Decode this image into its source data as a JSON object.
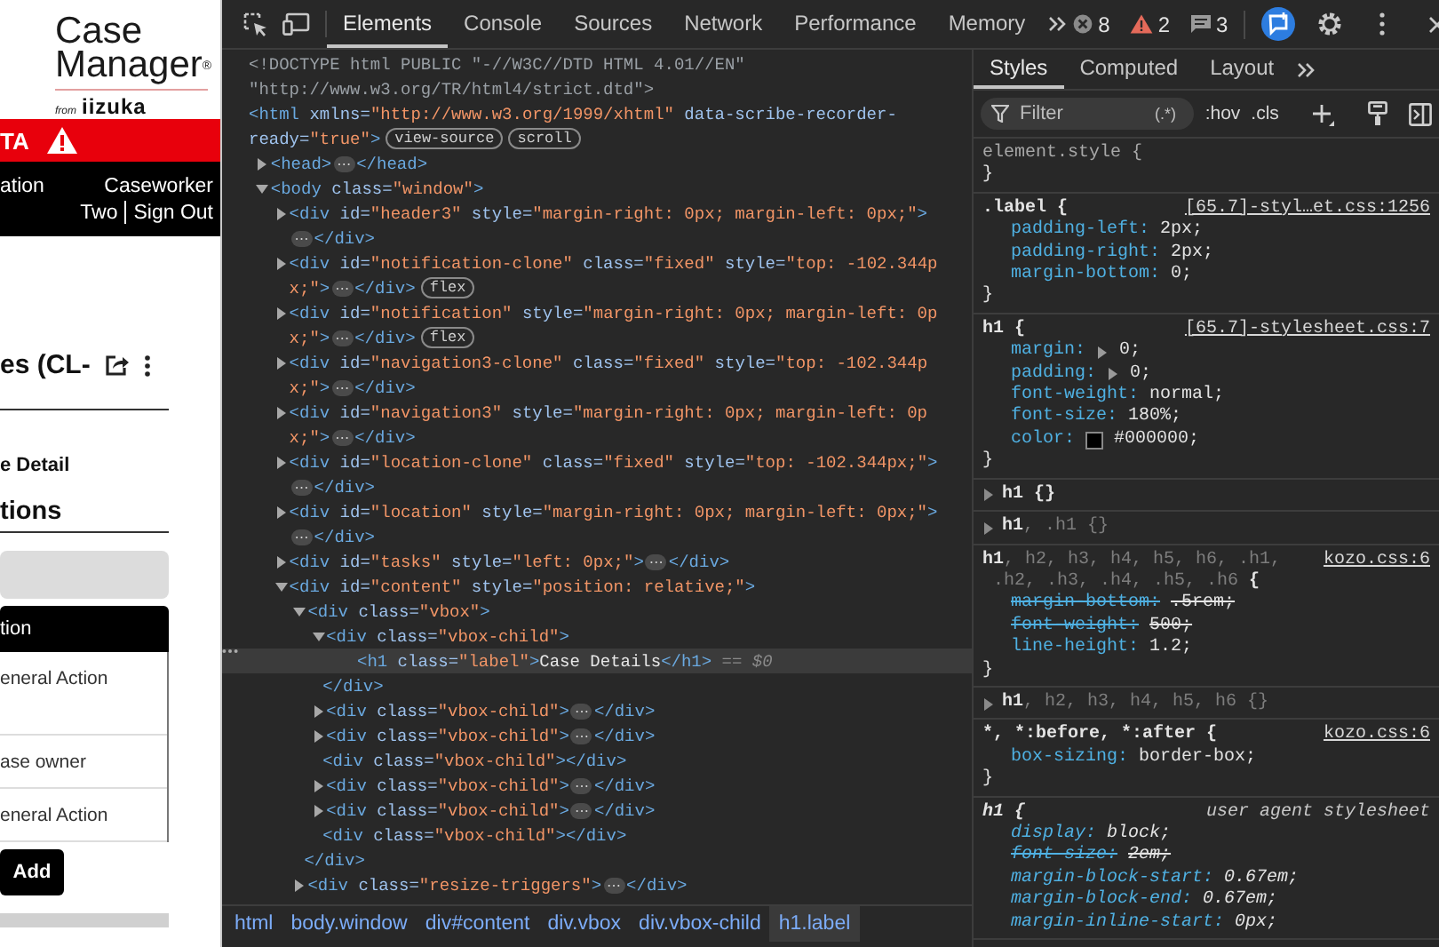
{
  "app_preview": {
    "logo": {
      "title_lines": [
        "Case",
        "Manager"
      ],
      "mark": "®",
      "byline_prefix": "from",
      "byline_brand": "iizuka"
    },
    "alert_bar": {
      "text": "TA"
    },
    "nav": {
      "left": "ation",
      "user_first": "Caseworker",
      "user_second": "Two",
      "sign_out": "Sign Out"
    },
    "case_title": "es (CL-",
    "section_label": "e Detail",
    "section_heading": "tions",
    "actions_header": "tion",
    "action_items": [
      {
        "text": "eneral Action"
      },
      {
        "text": "ase owner"
      },
      {
        "text": "eneral Action"
      }
    ],
    "add_button": "Add"
  },
  "devtools": {
    "toolbar": {
      "tabs": [
        {
          "label": "Elements",
          "selected": true
        },
        {
          "label": "Console",
          "selected": false
        },
        {
          "label": "Sources",
          "selected": false
        },
        {
          "label": "Network",
          "selected": false
        },
        {
          "label": "Performance",
          "selected": false
        },
        {
          "label": "Memory",
          "selected": false
        }
      ],
      "errors": "8",
      "warnings": "2",
      "messages": "3"
    },
    "elements": {
      "tree": [
        {
          "selected": false,
          "lines": [
            [
              {
                "kind": "doctype",
                "text": "<!DOCTYPE html PUBLIC \"-//W3C//DTD HTML 4.01//EN\""
              }
            ],
            [
              {
                "kind": "doctype",
                "text": "\"http://www.w3.org/TR/html4/strict.dtd\">"
              }
            ]
          ]
        },
        {
          "selected": false,
          "lines": [
            [
              {
                "kind": "tag",
                "text": "<html"
              },
              {
                "kind": "attr",
                "text": " xmlns="
              },
              {
                "kind": "value",
                "text": "\"http://www.w3.org/1999/xhtml\""
              },
              {
                "kind": "attr",
                "text": " data-scribe-recorder-"
              }
            ],
            [
              {
                "kind": "attr",
                "text": "ready="
              },
              {
                "kind": "value",
                "text": "\"true\""
              },
              {
                "kind": "tag",
                "text": ">"
              },
              {
                "kind": "badge",
                "text": "view-source"
              },
              {
                "kind": "badge",
                "text": "scroll"
              }
            ]
          ],
          "children": [
            {
              "selected": false,
              "expanded": false,
              "lines": [
                [
                  {
                    "kind": "tag",
                    "text": "<head>"
                  },
                  {
                    "kind": "ellipsis",
                    "text": "⋯"
                  },
                  {
                    "kind": "tag",
                    "text": "</head>"
                  }
                ]
              ]
            },
            {
              "selected": false,
              "expanded": true,
              "lines": [
                [
                  {
                    "kind": "tag",
                    "text": "<body"
                  },
                  {
                    "kind": "attr",
                    "text": " class="
                  },
                  {
                    "kind": "value",
                    "text": "\"window\""
                  },
                  {
                    "kind": "tag",
                    "text": ">"
                  }
                ]
              ],
              "children": [
                {
                  "selected": false,
                  "expanded": false,
                  "lines": [
                    [
                      {
                        "kind": "tag",
                        "text": "<div"
                      },
                      {
                        "kind": "attr",
                        "text": " id="
                      },
                      {
                        "kind": "value",
                        "text": "\"header3\""
                      },
                      {
                        "kind": "attr",
                        "text": " style="
                      },
                      {
                        "kind": "value",
                        "text": "\"margin-right: 0px; margin-left: 0px;\""
                      },
                      {
                        "kind": "tag",
                        "text": ">"
                      }
                    ],
                    [
                      {
                        "kind": "ellipsis",
                        "text": "⋯"
                      },
                      {
                        "kind": "tag",
                        "text": "</div>"
                      }
                    ]
                  ]
                },
                {
                  "selected": false,
                  "expanded": false,
                  "lines": [
                    [
                      {
                        "kind": "tag",
                        "text": "<div"
                      },
                      {
                        "kind": "attr",
                        "text": " id="
                      },
                      {
                        "kind": "value",
                        "text": "\"notification-clone\""
                      },
                      {
                        "kind": "attr",
                        "text": " class="
                      },
                      {
                        "kind": "value",
                        "text": "\"fixed\""
                      },
                      {
                        "kind": "attr",
                        "text": " style="
                      },
                      {
                        "kind": "value",
                        "text": "\"top: -102.344p"
                      }
                    ],
                    [
                      {
                        "kind": "value",
                        "text": "x;\""
                      },
                      {
                        "kind": "tag",
                        "text": ">"
                      },
                      {
                        "kind": "ellipsis",
                        "text": "⋯"
                      },
                      {
                        "kind": "tag",
                        "text": "</div>"
                      },
                      {
                        "kind": "badge",
                        "text": "flex"
                      }
                    ]
                  ]
                },
                {
                  "selected": false,
                  "expanded": false,
                  "lines": [
                    [
                      {
                        "kind": "tag",
                        "text": "<div"
                      },
                      {
                        "kind": "attr",
                        "text": " id="
                      },
                      {
                        "kind": "value",
                        "text": "\"notification\""
                      },
                      {
                        "kind": "attr",
                        "text": " style="
                      },
                      {
                        "kind": "value",
                        "text": "\"margin-right: 0px; margin-left: 0p"
                      }
                    ],
                    [
                      {
                        "kind": "value",
                        "text": "x;\""
                      },
                      {
                        "kind": "tag",
                        "text": ">"
                      },
                      {
                        "kind": "ellipsis",
                        "text": "⋯"
                      },
                      {
                        "kind": "tag",
                        "text": "</div>"
                      },
                      {
                        "kind": "badge",
                        "text": "flex"
                      }
                    ]
                  ]
                },
                {
                  "selected": false,
                  "expanded": false,
                  "lines": [
                    [
                      {
                        "kind": "tag",
                        "text": "<div"
                      },
                      {
                        "kind": "attr",
                        "text": " id="
                      },
                      {
                        "kind": "value",
                        "text": "\"navigation3-clone\""
                      },
                      {
                        "kind": "attr",
                        "text": " class="
                      },
                      {
                        "kind": "value",
                        "text": "\"fixed\""
                      },
                      {
                        "kind": "attr",
                        "text": " style="
                      },
                      {
                        "kind": "value",
                        "text": "\"top: -102.344p"
                      }
                    ],
                    [
                      {
                        "kind": "value",
                        "text": "x;\""
                      },
                      {
                        "kind": "tag",
                        "text": ">"
                      },
                      {
                        "kind": "ellipsis",
                        "text": "⋯"
                      },
                      {
                        "kind": "tag",
                        "text": "</div>"
                      }
                    ]
                  ]
                },
                {
                  "selected": false,
                  "expanded": false,
                  "lines": [
                    [
                      {
                        "kind": "tag",
                        "text": "<div"
                      },
                      {
                        "kind": "attr",
                        "text": " id="
                      },
                      {
                        "kind": "value",
                        "text": "\"navigation3\""
                      },
                      {
                        "kind": "attr",
                        "text": " style="
                      },
                      {
                        "kind": "value",
                        "text": "\"margin-right: 0px; margin-left: 0p"
                      }
                    ],
                    [
                      {
                        "kind": "value",
                        "text": "x;\""
                      },
                      {
                        "kind": "tag",
                        "text": ">"
                      },
                      {
                        "kind": "ellipsis",
                        "text": "⋯"
                      },
                      {
                        "kind": "tag",
                        "text": "</div>"
                      }
                    ]
                  ]
                },
                {
                  "selected": false,
                  "expanded": false,
                  "lines": [
                    [
                      {
                        "kind": "tag",
                        "text": "<div"
                      },
                      {
                        "kind": "attr",
                        "text": " id="
                      },
                      {
                        "kind": "value",
                        "text": "\"location-clone\""
                      },
                      {
                        "kind": "attr",
                        "text": " class="
                      },
                      {
                        "kind": "value",
                        "text": "\"fixed\""
                      },
                      {
                        "kind": "attr",
                        "text": " style="
                      },
                      {
                        "kind": "value",
                        "text": "\"top: -102.344px;\""
                      },
                      {
                        "kind": "tag",
                        "text": ">"
                      }
                    ],
                    [
                      {
                        "kind": "ellipsis",
                        "text": "⋯"
                      },
                      {
                        "kind": "tag",
                        "text": "</div>"
                      }
                    ]
                  ]
                },
                {
                  "selected": false,
                  "expanded": false,
                  "lines": [
                    [
                      {
                        "kind": "tag",
                        "text": "<div"
                      },
                      {
                        "kind": "attr",
                        "text": " id="
                      },
                      {
                        "kind": "value",
                        "text": "\"location\""
                      },
                      {
                        "kind": "attr",
                        "text": " style="
                      },
                      {
                        "kind": "value",
                        "text": "\"margin-right: 0px; margin-left: 0px;\""
                      },
                      {
                        "kind": "tag",
                        "text": ">"
                      }
                    ],
                    [
                      {
                        "kind": "ellipsis",
                        "text": "⋯"
                      },
                      {
                        "kind": "tag",
                        "text": "</div>"
                      }
                    ]
                  ]
                },
                {
                  "selected": false,
                  "expanded": false,
                  "lines": [
                    [
                      {
                        "kind": "tag",
                        "text": "<div"
                      },
                      {
                        "kind": "attr",
                        "text": " id="
                      },
                      {
                        "kind": "value",
                        "text": "\"tasks\""
                      },
                      {
                        "kind": "attr",
                        "text": " style="
                      },
                      {
                        "kind": "value",
                        "text": "\"left: 0px;\""
                      },
                      {
                        "kind": "tag",
                        "text": ">"
                      },
                      {
                        "kind": "ellipsis",
                        "text": "⋯"
                      },
                      {
                        "kind": "tag",
                        "text": "</div>"
                      }
                    ]
                  ]
                },
                {
                  "selected": false,
                  "expanded": true,
                  "lines": [
                    [
                      {
                        "kind": "tag",
                        "text": "<div"
                      },
                      {
                        "kind": "attr",
                        "text": " id="
                      },
                      {
                        "kind": "value",
                        "text": "\"content\""
                      },
                      {
                        "kind": "attr",
                        "text": " style="
                      },
                      {
                        "kind": "value",
                        "text": "\"position: relative;\""
                      },
                      {
                        "kind": "tag",
                        "text": ">"
                      }
                    ]
                  ],
                  "children": [
                    {
                      "selected": false,
                      "expanded": true,
                      "lines": [
                        [
                          {
                            "kind": "tag",
                            "text": "<div"
                          },
                          {
                            "kind": "attr",
                            "text": " class="
                          },
                          {
                            "kind": "value",
                            "text": "\"vbox\""
                          },
                          {
                            "kind": "tag",
                            "text": ">"
                          }
                        ]
                      ],
                      "closing": [
                        {
                          "kind": "tag",
                          "text": "</div>"
                        }
                      ],
                      "children": [
                        {
                          "selected": false,
                          "expanded": true,
                          "lines": [
                            [
                              {
                                "kind": "tag",
                                "text": "<div"
                              },
                              {
                                "kind": "attr",
                                "text": " class="
                              },
                              {
                                "kind": "value",
                                "text": "\"vbox-child\""
                              },
                              {
                                "kind": "tag",
                                "text": ">"
                              }
                            ]
                          ],
                          "closing": [
                            {
                              "kind": "tag",
                              "text": "</div>"
                            }
                          ],
                          "children": [
                            {
                              "selected": true,
                              "lines": [
                                [
                                  {
                                    "kind": "tag",
                                    "text": "<h1"
                                  },
                                  {
                                    "kind": "attr",
                                    "text": " class="
                                  },
                                  {
                                    "kind": "value",
                                    "text": "\"label\""
                                  },
                                  {
                                    "kind": "tag",
                                    "text": ">"
                                  },
                                  {
                                    "kind": "text",
                                    "text": "Case Details"
                                  },
                                  {
                                    "kind": "tag",
                                    "text": "</h1>"
                                  },
                                  {
                                    "kind": "marker",
                                    "text": " == $0"
                                  }
                                ]
                              ]
                            }
                          ]
                        },
                        {
                          "selected": false,
                          "expanded": false,
                          "lines": [
                            [
                              {
                                "kind": "tag",
                                "text": "<div"
                              },
                              {
                                "kind": "attr",
                                "text": " class="
                              },
                              {
                                "kind": "value",
                                "text": "\"vbox-child\""
                              },
                              {
                                "kind": "tag",
                                "text": ">"
                              },
                              {
                                "kind": "ellipsis",
                                "text": "⋯"
                              },
                              {
                                "kind": "tag",
                                "text": "</div>"
                              }
                            ]
                          ]
                        },
                        {
                          "selected": false,
                          "expanded": false,
                          "lines": [
                            [
                              {
                                "kind": "tag",
                                "text": "<div"
                              },
                              {
                                "kind": "attr",
                                "text": " class="
                              },
                              {
                                "kind": "value",
                                "text": "\"vbox-child\""
                              },
                              {
                                "kind": "tag",
                                "text": ">"
                              },
                              {
                                "kind": "ellipsis",
                                "text": "⋯"
                              },
                              {
                                "kind": "tag",
                                "text": "</div>"
                              }
                            ]
                          ]
                        },
                        {
                          "selected": false,
                          "lines": [
                            [
                              {
                                "kind": "tag",
                                "text": "<div"
                              },
                              {
                                "kind": "attr",
                                "text": " class="
                              },
                              {
                                "kind": "value",
                                "text": "\"vbox-child\""
                              },
                              {
                                "kind": "tag",
                                "text": "></div>"
                              }
                            ]
                          ]
                        },
                        {
                          "selected": false,
                          "expanded": false,
                          "lines": [
                            [
                              {
                                "kind": "tag",
                                "text": "<div"
                              },
                              {
                                "kind": "attr",
                                "text": " class="
                              },
                              {
                                "kind": "value",
                                "text": "\"vbox-child\""
                              },
                              {
                                "kind": "tag",
                                "text": ">"
                              },
                              {
                                "kind": "ellipsis",
                                "text": "⋯"
                              },
                              {
                                "kind": "tag",
                                "text": "</div>"
                              }
                            ]
                          ]
                        },
                        {
                          "selected": false,
                          "expanded": false,
                          "lines": [
                            [
                              {
                                "kind": "tag",
                                "text": "<div"
                              },
                              {
                                "kind": "attr",
                                "text": " class="
                              },
                              {
                                "kind": "value",
                                "text": "\"vbox-child\""
                              },
                              {
                                "kind": "tag",
                                "text": ">"
                              },
                              {
                                "kind": "ellipsis",
                                "text": "⋯"
                              },
                              {
                                "kind": "tag",
                                "text": "</div>"
                              }
                            ]
                          ]
                        },
                        {
                          "selected": false,
                          "lines": [
                            [
                              {
                                "kind": "tag",
                                "text": "<div"
                              },
                              {
                                "kind": "attr",
                                "text": " class="
                              },
                              {
                                "kind": "value",
                                "text": "\"vbox-child\""
                              },
                              {
                                "kind": "tag",
                                "text": "></div>"
                              }
                            ]
                          ]
                        }
                      ]
                    },
                    {
                      "selected": false,
                      "expanded": false,
                      "lines": [
                        [
                          {
                            "kind": "tag",
                            "text": "<div"
                          },
                          {
                            "kind": "attr",
                            "text": " class="
                          },
                          {
                            "kind": "value",
                            "text": "\"resize-triggers\""
                          },
                          {
                            "kind": "tag",
                            "text": ">"
                          },
                          {
                            "kind": "ellipsis",
                            "text": "⋯"
                          },
                          {
                            "kind": "tag",
                            "text": "</div>"
                          }
                        ]
                      ]
                    }
                  ]
                }
              ]
            }
          ]
        }
      ],
      "breadcrumbs": [
        {
          "label": "html",
          "selected": false
        },
        {
          "label": "body.window",
          "selected": false
        },
        {
          "label": "div#content",
          "selected": false
        },
        {
          "label": "div.vbox",
          "selected": false
        },
        {
          "label": "div.vbox-child",
          "selected": false
        },
        {
          "label": "h1.label",
          "selected": true
        }
      ]
    },
    "styles": {
      "tabs": [
        {
          "label": "Styles",
          "selected": true
        },
        {
          "label": "Computed",
          "selected": false
        },
        {
          "label": "Layout",
          "selected": false
        }
      ],
      "filter": {
        "placeholder": "Filter"
      },
      "regex_toggle": "(.*)",
      "hov": ":hov",
      "cls": ".cls",
      "rules": [
        {
          "kind": "inline",
          "selector": [
            {
              "text": "element.style {",
              "matched": true
            }
          ],
          "close": "}"
        },
        {
          "kind": "author",
          "source": "[65.7]-styl…et.css:1256",
          "selector": [
            {
              "text": ".label {",
              "matched": true
            }
          ],
          "close": "}",
          "declarations": [
            {
              "property": "padding-left:",
              "value": "2px;",
              "struck": false
            },
            {
              "property": "padding-right:",
              "value": "2px;",
              "struck": false
            },
            {
              "property": "margin-bottom:",
              "value": "0;",
              "struck": false
            }
          ]
        },
        {
          "kind": "author",
          "source": "[65.7]-stylesheet.css:7",
          "selector": [
            {
              "text": "h1 {",
              "matched": true
            }
          ],
          "close": "}",
          "declarations": [
            {
              "property": "margin:",
              "value": "0;",
              "struck": false,
              "expandable": true
            },
            {
              "property": "padding:",
              "value": "0;",
              "struck": false,
              "expandable": true
            },
            {
              "property": "font-weight:",
              "value": "normal;",
              "struck": false
            },
            {
              "property": "font-size:",
              "value": "180%;",
              "struck": false
            },
            {
              "property": "color:",
              "value": "#000000;",
              "struck": false,
              "color": "#000000"
            }
          ]
        },
        {
          "kind": "collapsed",
          "selector": [
            {
              "text": "h1 {}",
              "matched": true
            }
          ]
        },
        {
          "kind": "collapsed",
          "selector": [
            {
              "text": "h1",
              "matched": true
            },
            {
              "text": ", .h1 {}",
              "matched": false
            }
          ]
        },
        {
          "kind": "author",
          "source": "kozo.css:6",
          "selector": [
            {
              "text": "h1",
              "matched": true
            },
            {
              "text": ", h2, h3, h4, h5, h6, .h1,",
              "matched": false
            },
            {
              "text": " .h2, .h3, .h4, .h5, .h6",
              "matched": false
            },
            {
              "text": " {",
              "matched": true
            }
          ],
          "close": "}",
          "declarations": [
            {
              "property": "margin-bottom:",
              "value": ".5rem;",
              "struck": true
            },
            {
              "property": "font-weight:",
              "value": "500;",
              "struck": true
            },
            {
              "property": "line-height:",
              "value": "1.2;",
              "struck": false
            }
          ]
        },
        {
          "kind": "collapsed",
          "selector": [
            {
              "text": "h1",
              "matched": true
            },
            {
              "text": ", h2, h3, h4, h5, h6 {}",
              "matched": false
            }
          ]
        },
        {
          "kind": "author",
          "source": "kozo.css:6",
          "selector": [
            {
              "text": "*, *:before, *:after {",
              "matched": true
            }
          ],
          "close": "}",
          "declarations": [
            {
              "property": "box-sizing:",
              "value": "border-box;",
              "struck": false
            }
          ]
        },
        {
          "kind": "agent",
          "source": "user agent stylesheet",
          "selector": [
            {
              "text": "h1 {",
              "matched": true
            }
          ],
          "declarations": [
            {
              "property": "display:",
              "value": "block;",
              "struck": false
            },
            {
              "property": "font-size:",
              "value": "2em;",
              "struck": true
            },
            {
              "property": "margin-block-start:",
              "value": "0.67em;",
              "struck": false
            },
            {
              "property": "margin-block-end:",
              "value": "0.67em;",
              "struck": false
            },
            {
              "property": "margin-inline-start:",
              "value": "0px;",
              "struck": false
            }
          ]
        }
      ]
    }
  }
}
